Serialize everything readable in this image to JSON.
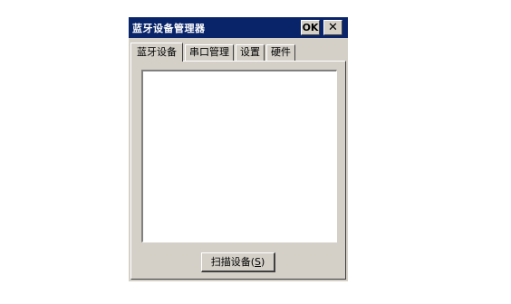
{
  "window": {
    "title": "蓝牙设备管理器",
    "ok_label": "OK",
    "close_glyph": "✕"
  },
  "tabs": [
    {
      "label": "蓝牙设备",
      "active": true
    },
    {
      "label": "串口管理",
      "active": false
    },
    {
      "label": "设置",
      "active": false
    },
    {
      "label": "硬件",
      "active": false
    }
  ],
  "device_list": {
    "items": []
  },
  "scan_button": {
    "label_prefix": "扫描设备(",
    "mnemonic": "S",
    "label_suffix": ")"
  },
  "colors": {
    "titlebar": "#0a246a",
    "face": "#d4d0c8"
  }
}
